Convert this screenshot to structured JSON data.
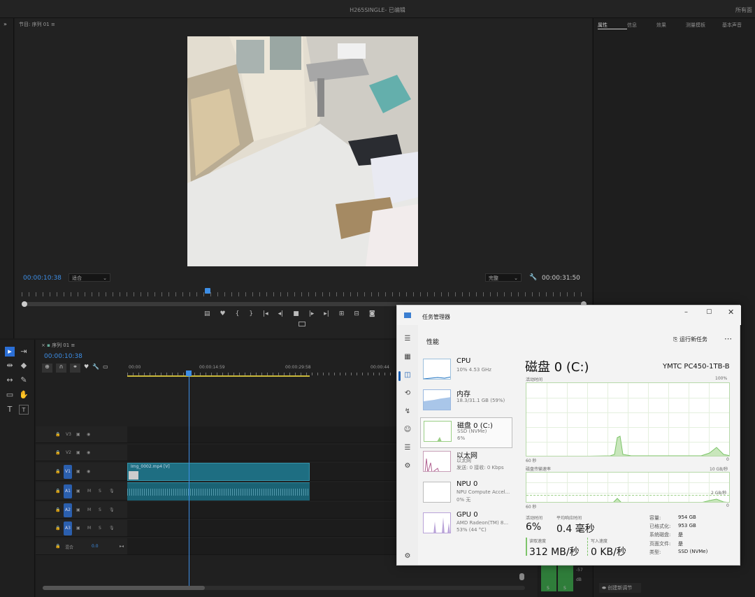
{
  "app": {
    "title": "H265SINGLE- 已编辑",
    "top_right": "所有面"
  },
  "program": {
    "header": "节目: 序列 01",
    "timecode_current": "00:00:10:38",
    "fit_label": "适合",
    "quality_label": "完整",
    "timecode_duration": "00:00:31:50"
  },
  "right_panel": {
    "tabs": [
      "属性",
      "信息",
      "效果",
      "测量模板",
      "基本声音"
    ],
    "footer_button": "创建新调节"
  },
  "timeline": {
    "tab_label": "序列 01",
    "timecode": "00:00:10:38",
    "ruler": [
      "00:00",
      "00:00:14:59",
      "00:00:29:58",
      "00:00:44"
    ],
    "tracks": {
      "v3": "V3",
      "v2": "V2",
      "v1": "V1",
      "a1": "A1",
      "a2": "A2",
      "a3": "A3",
      "mix": "混合",
      "mix_value": "0.0",
      "m": "M",
      "s": "S"
    },
    "video_clip_name": "Img_0002.mp4 [V]"
  },
  "meter": {
    "labels": [
      "S",
      "S"
    ],
    "db1": "-57",
    "db2": "dB"
  },
  "task_manager": {
    "title": "任务管理器",
    "section": "性能",
    "run_task": "运行新任务",
    "items": [
      {
        "name": "CPU",
        "sub1": "10% 4.53 GHz",
        "sub2": ""
      },
      {
        "name": "内存",
        "sub1": "18.3/31.1 GB (59%)",
        "sub2": ""
      },
      {
        "name": "磁盘 0 (C:)",
        "sub1": "SSD (NVMe)",
        "sub2": "6%"
      },
      {
        "name": "以太网",
        "sub1": "以太网",
        "sub2": "发送: 0 接收: 0 Kbps"
      },
      {
        "name": "NPU 0",
        "sub1": "NPU Compute Accel...",
        "sub2": "0% 无"
      },
      {
        "name": "GPU 0",
        "sub1": "AMD Radeon(TM) 8...",
        "sub2": "53% (44 °C)"
      }
    ],
    "detail": {
      "title": "磁盘 0 (C:)",
      "model": "YMTC PC450-1TB-B",
      "chart1_label": "活动时间",
      "chart1_max": "100%",
      "chart1_time": "60 秒",
      "chart1_min": "0",
      "chart2_label": "磁盘传输速率",
      "chart2_max": "10 GB/秒",
      "chart2_mid": "2 GB/秒",
      "chart2_time": "60 秒",
      "chart2_min": "0",
      "active_time_label": "活动时间",
      "active_time": "6%",
      "avg_resp_label": "平均响应时间",
      "avg_resp": "0.4 毫秒",
      "read_label": "读取速度",
      "read": "312 MB/秒",
      "write_label": "写入速度",
      "write": "0 KB/秒",
      "props": [
        {
          "k": "容量:",
          "v": "954 GB"
        },
        {
          "k": "已格式化:",
          "v": "953 GB"
        },
        {
          "k": "系统磁盘:",
          "v": "是"
        },
        {
          "k": "页面文件:",
          "v": "是"
        },
        {
          "k": "类型:",
          "v": "SSD (NVMe)"
        }
      ]
    }
  },
  "colors": {
    "accent_blue": "#3d8ee6",
    "clip_teal": "#1e6e82",
    "tm_green": "#7dc46a"
  }
}
